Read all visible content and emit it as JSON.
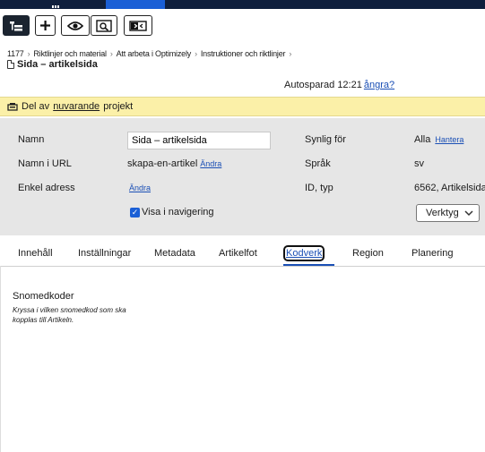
{
  "toolbar": {
    "icons": [
      "tree-icon",
      "plus-icon",
      "eye-icon",
      "preview-icon",
      "compare-icon"
    ]
  },
  "breadcrumb": [
    "1177",
    "Riktlinjer och material",
    "Att arbeta i Optimizely",
    "Instruktioner och riktlinjer"
  ],
  "page": {
    "title": "Sida – artikelsida"
  },
  "autosave": {
    "text": "Autosparad 12:21",
    "undo": "ångra?"
  },
  "project": {
    "prefix": "Del av",
    "link": "nuvarande",
    "suffix": "projekt"
  },
  "properties": {
    "name_label": "Namn",
    "name_value": "Sida – artikelsida",
    "url_label": "Namn i URL",
    "url_value": "skapa-en-artikel",
    "url_change": "Ändra",
    "simple_label": "Enkel adress",
    "simple_change": "Ändra",
    "visible_label": "Synlig för",
    "visible_value": "Alla",
    "visible_manage": "Hantera",
    "lang_label": "Språk",
    "lang_value": "sv",
    "id_label": "ID, typ",
    "id_value": "6562, Artikelsida",
    "show_nav": "Visa i navigering",
    "show_nav_checked": true,
    "tools": "Verktyg"
  },
  "tabs": [
    {
      "label": "Innehåll"
    },
    {
      "label": "Inställningar"
    },
    {
      "label": "Metadata"
    },
    {
      "label": "Artikelfot"
    },
    {
      "label": "Kodverk",
      "active": true
    },
    {
      "label": "Region"
    },
    {
      "label": "Planering"
    }
  ],
  "content": {
    "title": "Snomedkoder",
    "description": "Kryssa i vilken snomedkod som ska kopplas till Artikeln."
  },
  "colors": {
    "accent": "#1a4fb5",
    "project_bar": "#fbf0a8",
    "props_bg": "#e6e6e6",
    "topbar": "#0f1f3d"
  }
}
